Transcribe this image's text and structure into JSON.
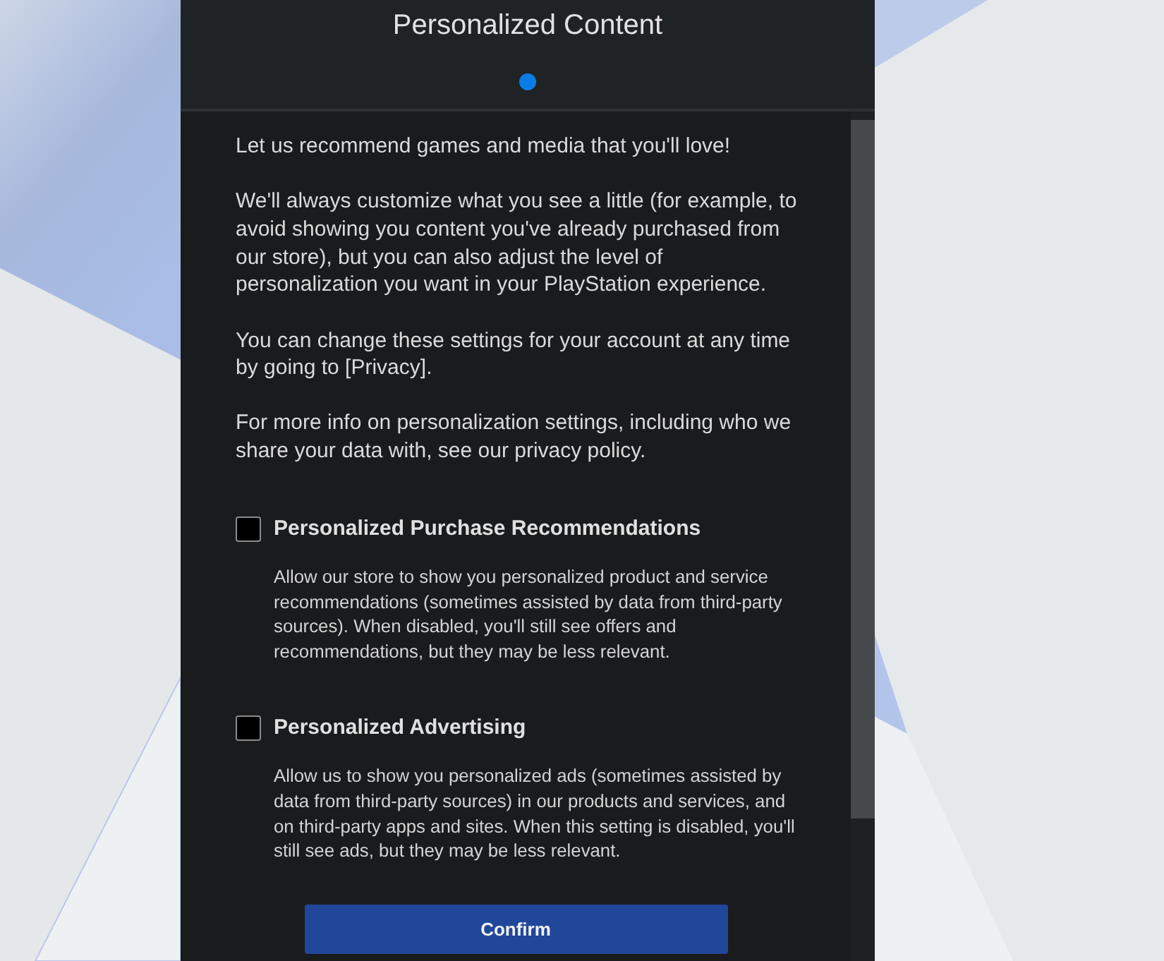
{
  "header": {
    "title": "Personalized Content",
    "steps": [
      {
        "selected": true
      }
    ]
  },
  "intro": [
    "Let us recommend games and media that you'll love!",
    "We'll always customize what you see a little (for example, to avoid showing you content you've already purchased from our store), but you can also adjust the level of personalization you want in your PlayStation experience.",
    "You can change these settings for your account at any time by going to [Privacy].",
    "For more info on personalization settings, including who we share your data with, see our privacy policy."
  ],
  "options": [
    {
      "label": "Personalized Purchase Recommendations",
      "checked": false,
      "description": "Allow our store to show you personalized product and service recommendations (sometimes assisted by data from third-party sources). When disabled, you'll still see offers and recommendations, but they may be less relevant."
    },
    {
      "label": "Personalized Advertising",
      "checked": false,
      "description": "Allow us to show you personalized ads (sometimes assisted by data from third-party sources) in our products and services, and on third-party apps and sites. When this setting is disabled, you'll still see ads, but they may be less relevant."
    }
  ],
  "confirm_button": {
    "label": "Confirm"
  }
}
